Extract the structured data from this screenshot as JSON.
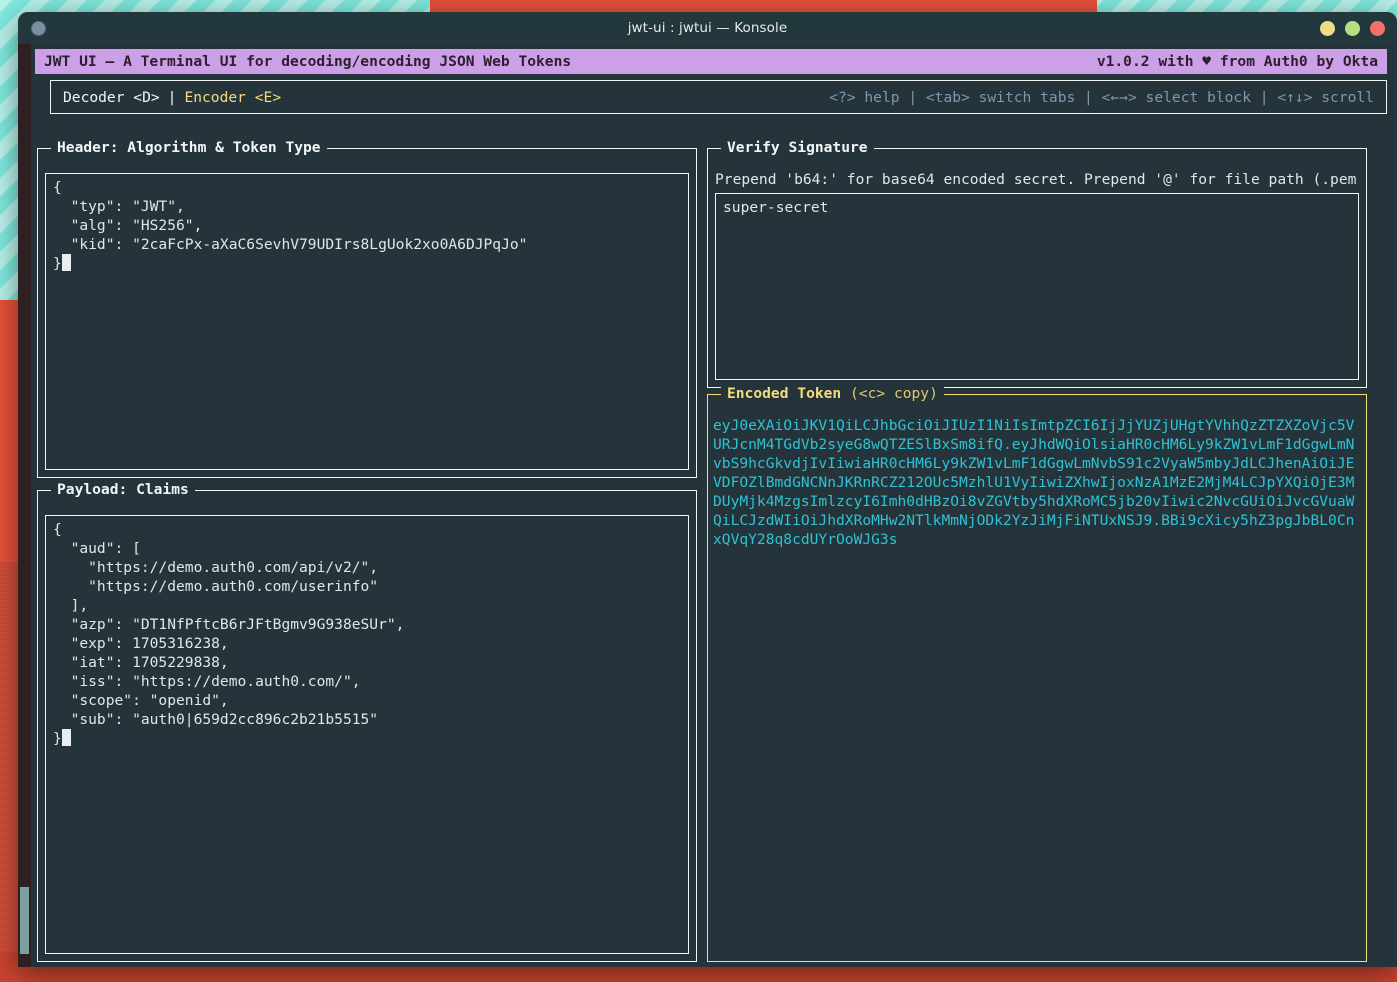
{
  "window": {
    "title": "jwt-ui : jwtui — Konsole",
    "controls": {
      "minimize": "minimize-button",
      "maximize": "maximize-button",
      "close": "close-button"
    }
  },
  "app_header": {
    "title": "JWT UI – A Terminal UI for decoding/encoding JSON Web Tokens",
    "version": "v1.0.2 with ♥ from Auth0 by Okta",
    "bg_color": "#cd9fe6",
    "fg_color": "#2b2030"
  },
  "navbar": {
    "tabs": [
      {
        "label": "Decoder <D>",
        "active": false
      },
      {
        "label": "Encoder <E>",
        "active": true
      }
    ],
    "separator": "|",
    "keybinds": "<?> help | <tab> switch tabs | <←→> select block | <↑↓> scroll",
    "keybind_color": "#7e98ae",
    "active_tab_color": "#f5dd7e"
  },
  "panels": {
    "header": {
      "title": "Header: Algorithm & Token Type",
      "active": false,
      "content": "{\n  \"typ\": \"JWT\",\n  \"alg\": \"HS256\",\n  \"kid\": \"2caFcPx-aXaC6SevhV79UDIrs8LgUok2xo0A6DJPqJo\"\n}"
    },
    "payload": {
      "title": "Payload: Claims",
      "active": false,
      "content": "{\n  \"aud\": [\n    \"https://demo.auth0.com/api/v2/\",\n    \"https://demo.auth0.com/userinfo\"\n  ],\n  \"azp\": \"DT1NfPftcB6rJFtBgmv9G938eSUr\",\n  \"exp\": 1705316238,\n  \"iat\": 1705229838,\n  \"iss\": \"https://demo.auth0.com/\",\n  \"scope\": \"openid\",\n  \"sub\": \"auth0|659d2cc896c2b21b5515\"\n}"
    },
    "signature": {
      "title": "Verify Signature",
      "active": false,
      "hint": "Prepend 'b64:' for base64 encoded secret. Prepend '@' for file path (.pem",
      "value": "super-secret"
    },
    "token": {
      "title": "Encoded Token",
      "title_hint": "(<c> copy)",
      "active": true,
      "border_color": "#f5dd7e",
      "text_color": "#2fc2d4",
      "value": "eyJ0eXAiOiJKV1QiLCJhbGciOiJIUzI1NiIsImtpZCI6IjJjYUZjUHgtYVhhQzZTZXZoVjc5VURJcnM4TGdVb2syeG8wQTZESlBxSm8ifQ.eyJhdWQiOlsiaHR0cHM6Ly9kZW1vLmF1dGgwLmNvbS9hcGkvdjIvIiwiaHR0cHM6Ly9kZW1vLmF1dGgwLmNvbS91c2VyaW5mbyJdLCJhenAiOiJEVDFOZlBmdGNCNnJKRnRCZ212OUc5MzhlU1VyIiwiZXhwIjoxNzA1MzE2MjM4LCJpYXQiOjE3MDUyMjk4MzgsImlzcyI6Imh0dHBzOi8vZGVtby5hdXRoMC5jb20vIiwic2NvcGUiOiJvcGVuaWQiLCJzdWIiOiJhdXRoMHw2NTlkMmNjODk2YzJiMjFiNTUxNSJ9.BBi9cXicy5hZ3pgJbBL0CnxQVqY28q8cdUYrOoWJG3s"
    }
  }
}
